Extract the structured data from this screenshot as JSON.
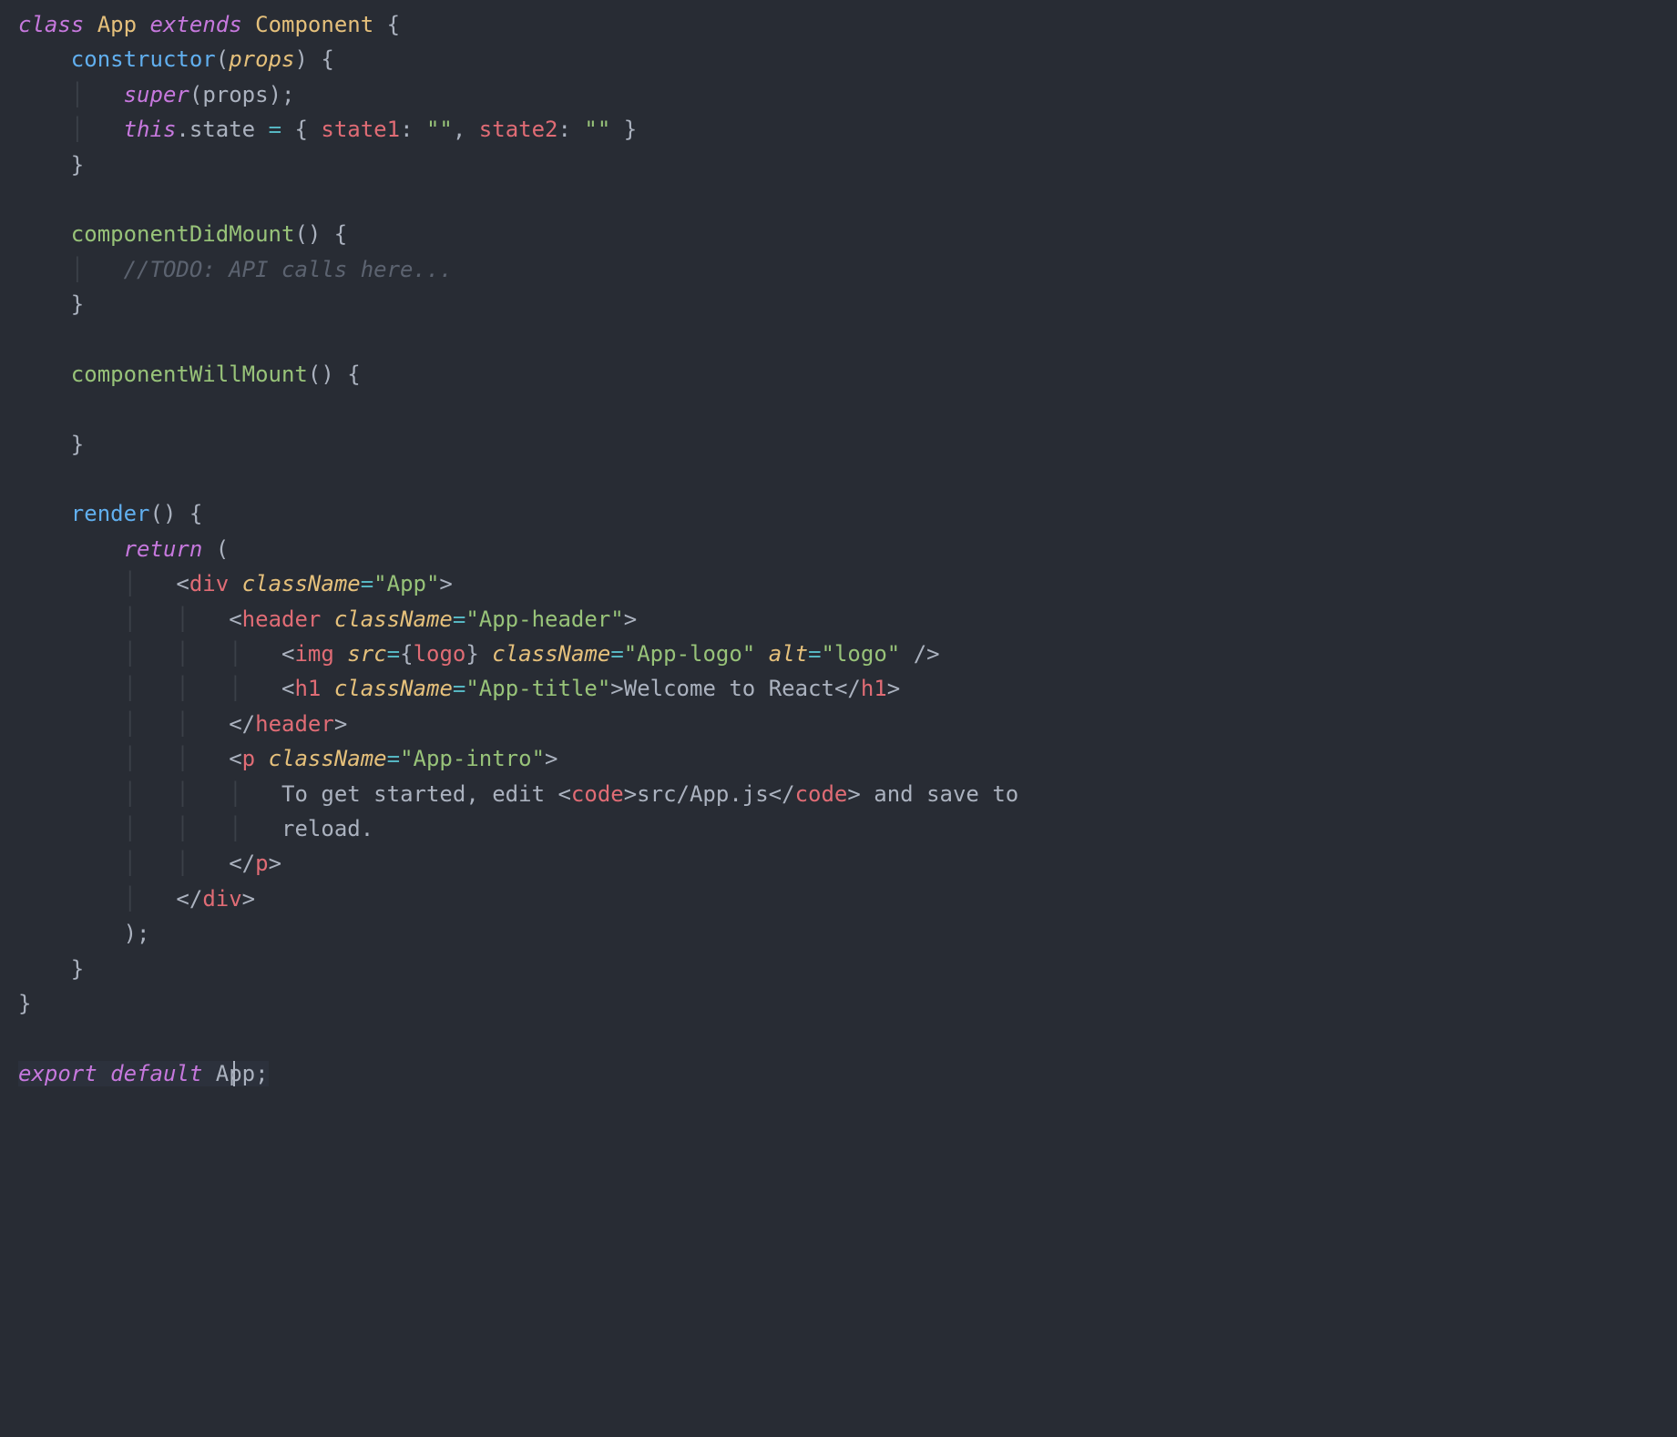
{
  "code": {
    "class_kw": "class",
    "class_name": "App",
    "extends_kw": "extends",
    "base_name": "Component",
    "open_brace": "{",
    "ctor_name": "constructor",
    "ctor_param": "props",
    "super_kw": "super",
    "super_arg": "props",
    "this_kw": "this",
    "state_prop": "state",
    "state_key1": "state1",
    "state_val1": "\"\"",
    "state_key2": "state2",
    "state_val2": "\"\"",
    "cdm_name": "componentDidMount",
    "cdm_comment": "//TODO: API calls here...",
    "cwm_name": "componentWillMount",
    "render_name": "render",
    "return_kw": "return",
    "div_tag": "div",
    "className_attr": "className",
    "app_class": "\"App\"",
    "header_tag": "header",
    "app_header_class": "\"App-header\"",
    "img_tag": "img",
    "src_attr": "src",
    "logo_expr": "logo",
    "app_logo_class": "\"App-logo\"",
    "alt_attr": "alt",
    "alt_val": "\"logo\"",
    "h1_tag": "h1",
    "app_title_class": "\"App-title\"",
    "h1_text": "Welcome to React",
    "p_tag": "p",
    "app_intro_class": "\"App-intro\"",
    "p_text1": "To get started, edit ",
    "code_tag": "code",
    "code_text": "src/App.js",
    "p_text2": " and save to",
    "p_text3": "reload.",
    "export_kw": "export",
    "default_kw": "default",
    "export_name": "App"
  }
}
